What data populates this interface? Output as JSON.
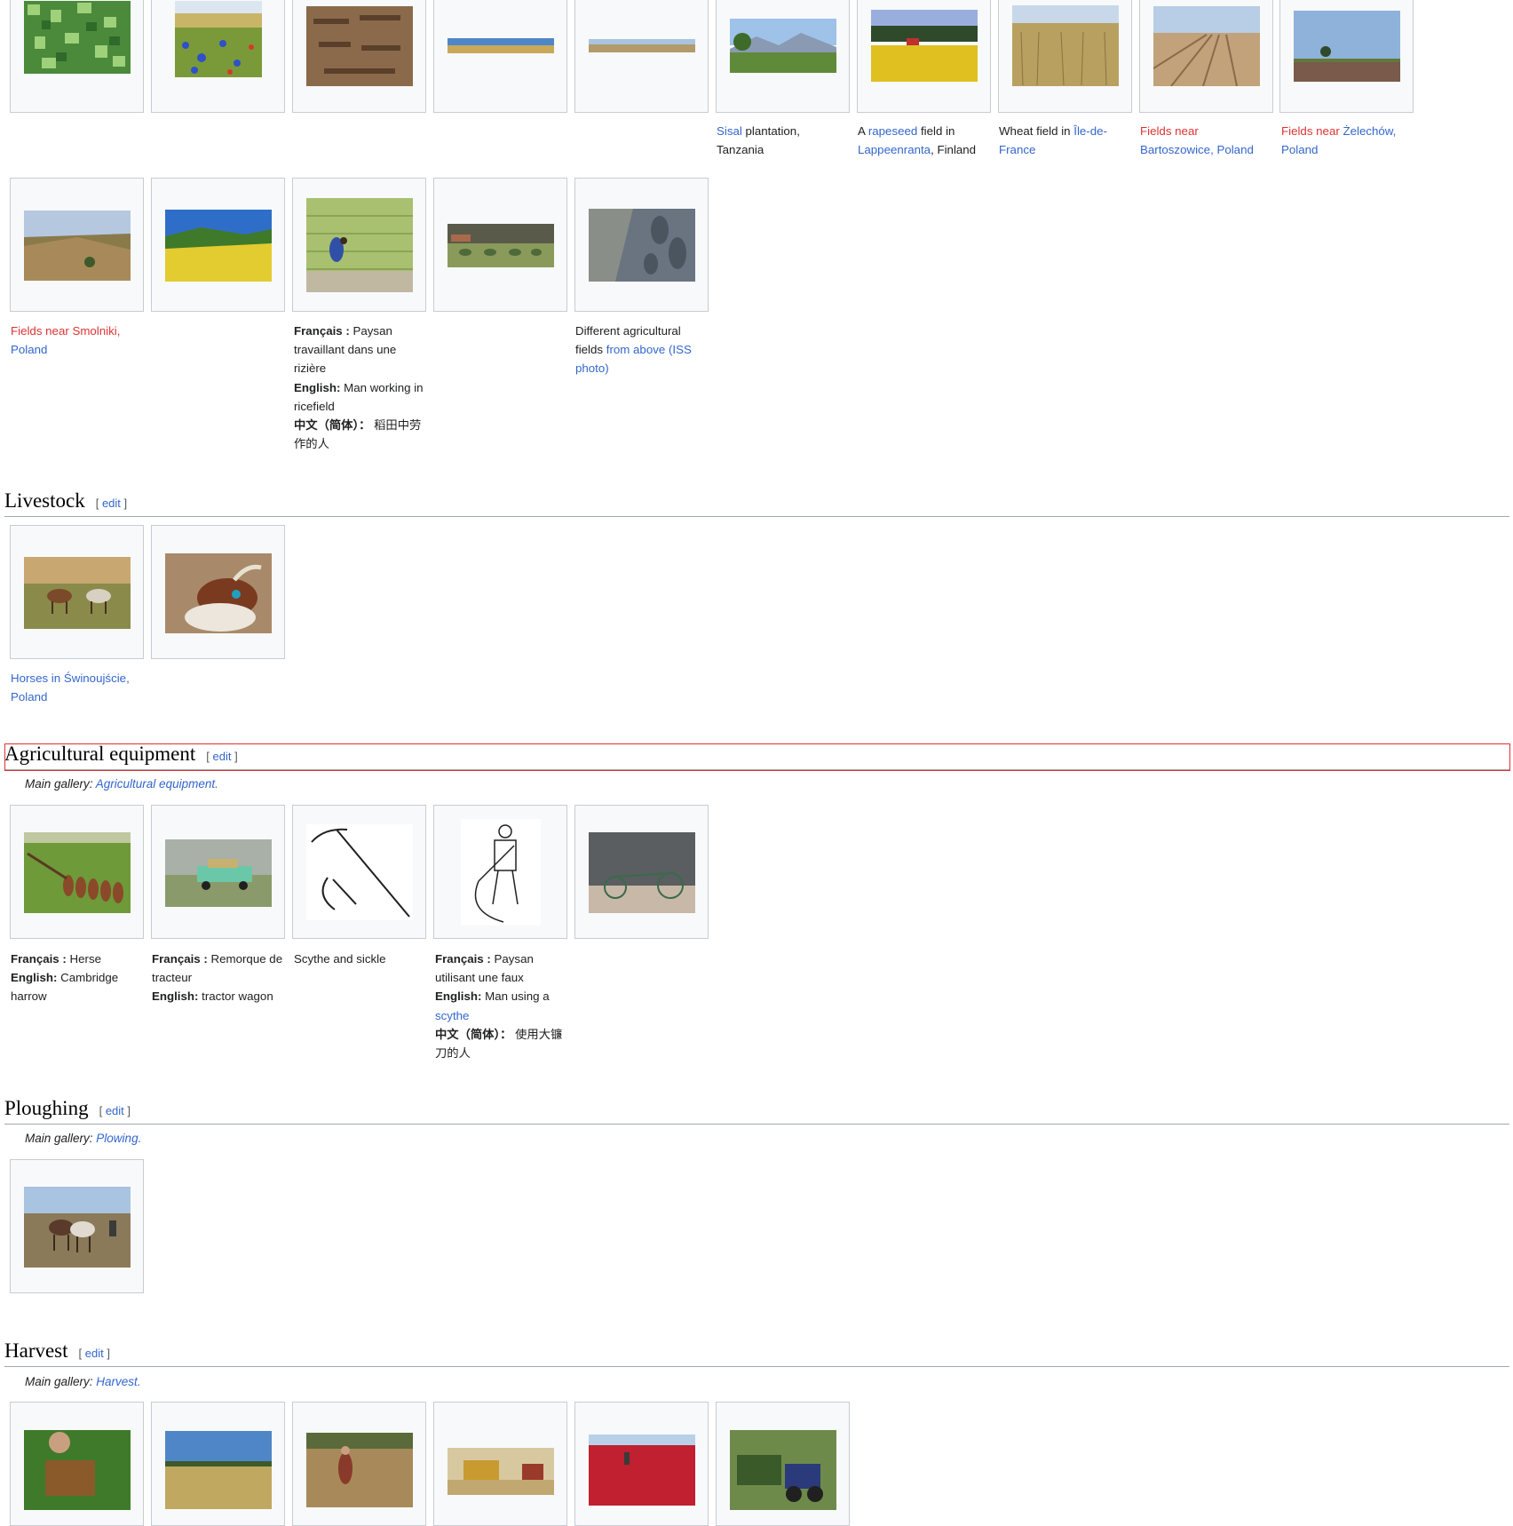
{
  "sections": {
    "livestock": {
      "title": "Livestock",
      "edit": "edit"
    },
    "equipment": {
      "title": "Agricultural equipment",
      "edit": "edit",
      "main_gallery_label": "Main gallery:",
      "main_gallery_link": "Agricultural equipment",
      "main_gallery_end": "."
    },
    "ploughing": {
      "title": "Ploughing",
      "edit": "edit",
      "main_gallery_label": "Main gallery:",
      "main_gallery_link": "Plowing",
      "main_gallery_end": "."
    },
    "harvest": {
      "title": "Harvest",
      "edit": "edit",
      "main_gallery_label": "Main gallery:",
      "main_gallery_link": "Harvest",
      "main_gallery_end": "."
    }
  },
  "captions": {
    "sisal": {
      "link": "Sisal",
      "text": " plantation,",
      "text2": "Tanzania"
    },
    "rapeseed": {
      "a": "A ",
      "link": "rapeseed",
      "text": " field in",
      "link2": "Lappeenranta",
      "text2": ", Finland"
    },
    "wheat": {
      "text": "Wheat field in ",
      "link": "Île-de-",
      "link2": "France"
    },
    "bartoszowice": {
      "red": "Fields near",
      "link": "Bartoszowice, Poland"
    },
    "zelechow": {
      "red": "Fields near ",
      "link": "Żelechów,",
      "link2": "Poland"
    },
    "smolniki": {
      "red": "Fields near Smolniki,",
      "link": "Poland"
    },
    "rice": {
      "fr_label": "Français :",
      "fr_text1": " Paysan",
      "fr_text2": "travaillant dans une",
      "fr_text3": "rizière",
      "en_label": "English:",
      "en_text1": " Man working in",
      "en_text2": "ricefield",
      "zh_label": "中文（简体）：",
      "zh_text1": " 稻田中劳",
      "zh_text2": "作的人"
    },
    "iss": {
      "text1": "Different agricultural",
      "text2": "fields ",
      "link": "from above (ISS",
      "link2": "photo)"
    },
    "horses": {
      "link": "Horses in Świnoujście,",
      "link2": "Poland"
    },
    "harrow": {
      "fr_label": "Français :",
      "fr_text": " Herse",
      "en_label": "English:",
      "en_text": " Cambridge",
      "en_text2": "harrow"
    },
    "wagon": {
      "fr_label": "Français :",
      "fr_text": " Remorque de",
      "fr_text2": "tracteur",
      "en_label": "English:",
      "en_text": " tractor wagon"
    },
    "scythe_sickle": {
      "text": "Scythe and sickle"
    },
    "scythe_man": {
      "fr_label": "Français :",
      "fr_text1": " Paysan",
      "fr_text2": "utilisant une faux",
      "en_label": "English:",
      "en_text1": " Man using a",
      "en_link": "scythe",
      "zh_label": "中文（简体）：",
      "zh_text1": " 使用大镰",
      "zh_text2": "刀的人"
    }
  },
  "colors": {
    "link": "#3366cc",
    "redlink": "#dd3333",
    "frame_bg": "#f8f9fa",
    "frame_border": "#c8ccd1",
    "highlight": "#dd3333"
  },
  "images": [
    "crop-fields-satellite",
    "wildflower-field",
    "ploughed-pits",
    "wide-field-panorama-1",
    "wide-field-panorama-2",
    "sisal-plantation",
    "rapeseed-field",
    "wheat-field",
    "bartoszowice-fields",
    "zelechow-fields",
    "smolniki-fields",
    "yellow-rapeseed-hills",
    "rice-paddy-worker",
    "hay-bales-field",
    "iss-aerial-fields",
    "horses",
    "goat",
    "harrow",
    "tractor-wagon",
    "scythe-and-sickle",
    "man-with-scythe",
    "old-hay-rake",
    "ploughing-horses",
    "hand-harvest",
    "harvested-field",
    "woman-harvesting",
    "combine-harvester",
    "cranberry-harvest",
    "forage-harvester"
  ]
}
